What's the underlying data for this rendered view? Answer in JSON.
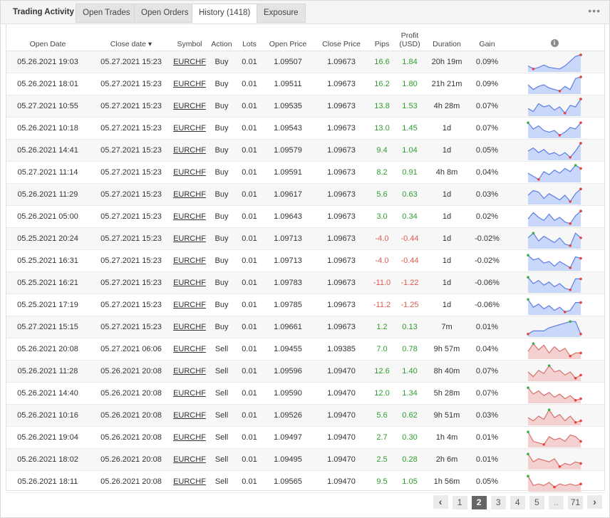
{
  "tabs": {
    "title": "Trading Activity",
    "items": [
      "Open Trades",
      "Open Orders",
      "History (1418)",
      "Exposure"
    ],
    "more_icon": "more-dots-icon"
  },
  "columns": {
    "open_date": "Open Date",
    "close_date": "Close date",
    "sort_indicator": "▾",
    "symbol": "Symbol",
    "action": "Action",
    "lots": "Lots",
    "open_price": "Open Price",
    "close_price": "Close Price",
    "pips": "Pips",
    "profit_line1": "Profit",
    "profit_line2": "(USD)",
    "duration": "Duration",
    "gain": "Gain",
    "info_icon": "i"
  },
  "colors": {
    "positive": "#2e9e2e",
    "negative": "#e05a4f",
    "buy_fill": "#c9d7fb",
    "buy_line": "#5d7de6",
    "sell_fill": "#f3d1d1",
    "sell_line": "#d9706c"
  },
  "rows": [
    {
      "open": "05.26.2021 19:03",
      "close": "05.27.2021 15:23",
      "symbol": "EURCHF",
      "action": "Buy",
      "lots": "0.01",
      "open_price": "1.09507",
      "close_price": "1.09673",
      "pips": "16.6",
      "profit": "1.84",
      "duration": "20h 19m",
      "gain": "0.09%",
      "sign": "pos",
      "spark": [
        0.3,
        0.1,
        0.2,
        0.35,
        0.2,
        0.15,
        0.1,
        0.3,
        0.6,
        0.9,
        1.0
      ]
    },
    {
      "open": "05.26.2021 18:01",
      "close": "05.27.2021 15:23",
      "symbol": "EURCHF",
      "action": "Buy",
      "lots": "0.01",
      "open_price": "1.09511",
      "close_price": "1.09673",
      "pips": "16.2",
      "profit": "1.80",
      "duration": "21h 21m",
      "gain": "0.09%",
      "sign": "pos",
      "spark": [
        0.5,
        0.2,
        0.4,
        0.5,
        0.3,
        0.2,
        0.1,
        0.4,
        0.2,
        0.9,
        1.0
      ]
    },
    {
      "open": "05.27.2021 10:55",
      "close": "05.27.2021 15:23",
      "symbol": "EURCHF",
      "action": "Buy",
      "lots": "0.01",
      "open_price": "1.09535",
      "close_price": "1.09673",
      "pips": "13.8",
      "profit": "1.53",
      "duration": "4h 28m",
      "gain": "0.07%",
      "sign": "pos",
      "spark": [
        0.4,
        0.2,
        0.7,
        0.5,
        0.6,
        0.3,
        0.5,
        0.1,
        0.6,
        0.5,
        1.0
      ]
    },
    {
      "open": "05.26.2021 10:18",
      "close": "05.27.2021 15:23",
      "symbol": "EURCHF",
      "action": "Buy",
      "lots": "0.01",
      "open_price": "1.09543",
      "close_price": "1.09673",
      "pips": "13.0",
      "profit": "1.45",
      "duration": "1d",
      "gain": "0.07%",
      "sign": "pos",
      "spark": [
        0.9,
        0.5,
        0.7,
        0.4,
        0.3,
        0.4,
        0.1,
        0.3,
        0.6,
        0.5,
        0.9
      ]
    },
    {
      "open": "05.26.2021 14:41",
      "close": "05.27.2021 15:23",
      "symbol": "EURCHF",
      "action": "Buy",
      "lots": "0.01",
      "open_price": "1.09579",
      "close_price": "1.09673",
      "pips": "9.4",
      "profit": "1.04",
      "duration": "1d",
      "gain": "0.05%",
      "sign": "pos",
      "spark": [
        0.5,
        0.7,
        0.4,
        0.6,
        0.3,
        0.4,
        0.2,
        0.4,
        0.1,
        0.5,
        1.0
      ]
    },
    {
      "open": "05.27.2021 11:14",
      "close": "05.27.2021 15:23",
      "symbol": "EURCHF",
      "action": "Buy",
      "lots": "0.01",
      "open_price": "1.09591",
      "close_price": "1.09673",
      "pips": "8.2",
      "profit": "0.91",
      "duration": "4h 8m",
      "gain": "0.04%",
      "sign": "pos",
      "spark": [
        0.5,
        0.3,
        0.1,
        0.6,
        0.4,
        0.7,
        0.5,
        0.8,
        0.6,
        1.0,
        0.8
      ]
    },
    {
      "open": "05.26.2021 11:29",
      "close": "05.27.2021 15:23",
      "symbol": "EURCHF",
      "action": "Buy",
      "lots": "0.01",
      "open_price": "1.09617",
      "close_price": "1.09673",
      "pips": "5.6",
      "profit": "0.63",
      "duration": "1d",
      "gain": "0.03%",
      "sign": "pos",
      "spark": [
        0.5,
        0.8,
        0.7,
        0.3,
        0.6,
        0.4,
        0.2,
        0.5,
        0.1,
        0.6,
        0.9
      ]
    },
    {
      "open": "05.26.2021 05:00",
      "close": "05.27.2021 15:23",
      "symbol": "EURCHF",
      "action": "Buy",
      "lots": "0.01",
      "open_price": "1.09643",
      "close_price": "1.09673",
      "pips": "3.0",
      "profit": "0.34",
      "duration": "1d",
      "gain": "0.02%",
      "sign": "pos",
      "spark": [
        0.4,
        0.8,
        0.5,
        0.3,
        0.7,
        0.3,
        0.5,
        0.2,
        0.1,
        0.6,
        0.9
      ]
    },
    {
      "open": "05.25.2021 20:24",
      "close": "05.27.2021 15:23",
      "symbol": "EURCHF",
      "action": "Buy",
      "lots": "0.01",
      "open_price": "1.09713",
      "close_price": "1.09673",
      "pips": "-4.0",
      "profit": "-0.44",
      "duration": "1d",
      "gain": "-0.02%",
      "sign": "neg",
      "spark": [
        0.6,
        0.9,
        0.4,
        0.7,
        0.5,
        0.3,
        0.6,
        0.2,
        0.1,
        0.9,
        0.6
      ]
    },
    {
      "open": "05.25.2021 16:31",
      "close": "05.27.2021 15:23",
      "symbol": "EURCHF",
      "action": "Buy",
      "lots": "0.01",
      "open_price": "1.09713",
      "close_price": "1.09673",
      "pips": "-4.0",
      "profit": "-0.44",
      "duration": "1d",
      "gain": "-0.02%",
      "sign": "neg",
      "spark": [
        0.9,
        0.6,
        0.7,
        0.4,
        0.5,
        0.2,
        0.5,
        0.3,
        0.1,
        0.8,
        0.7
      ]
    },
    {
      "open": "05.25.2021 16:21",
      "close": "05.27.2021 15:23",
      "symbol": "EURCHF",
      "action": "Buy",
      "lots": "0.01",
      "open_price": "1.09783",
      "close_price": "1.09673",
      "pips": "-11.0",
      "profit": "-1.22",
      "duration": "1d",
      "gain": "-0.06%",
      "sign": "neg",
      "spark": [
        0.9,
        0.5,
        0.7,
        0.4,
        0.6,
        0.3,
        0.5,
        0.2,
        0.1,
        0.8,
        0.8
      ]
    },
    {
      "open": "05.25.2021 17:19",
      "close": "05.27.2021 15:23",
      "symbol": "EURCHF",
      "action": "Buy",
      "lots": "0.01",
      "open_price": "1.09785",
      "close_price": "1.09673",
      "pips": "-11.2",
      "profit": "-1.25",
      "duration": "1d",
      "gain": "-0.06%",
      "sign": "neg",
      "spark": [
        0.9,
        0.4,
        0.6,
        0.3,
        0.5,
        0.2,
        0.4,
        0.1,
        0.2,
        0.7,
        0.7
      ]
    },
    {
      "open": "05.27.2021 15:15",
      "close": "05.27.2021 15:23",
      "symbol": "EURCHF",
      "action": "Buy",
      "lots": "0.01",
      "open_price": "1.09661",
      "close_price": "1.09673",
      "pips": "1.2",
      "profit": "0.13",
      "duration": "7m",
      "gain": "0.01%",
      "sign": "pos",
      "spark": [
        0.1,
        0.3,
        0.3,
        0.3,
        0.5,
        0.6,
        0.7,
        0.8,
        0.9,
        0.9,
        0.1
      ]
    },
    {
      "open": "05.26.2021 20:08",
      "close": "05.27.2021 06:06",
      "symbol": "EURCHF",
      "action": "Sell",
      "lots": "0.01",
      "open_price": "1.09455",
      "close_price": "1.09385",
      "pips": "7.0",
      "profit": "0.78",
      "duration": "9h 57m",
      "gain": "0.04%",
      "sign": "pos",
      "spark": [
        0.4,
        0.9,
        0.5,
        0.8,
        0.3,
        0.7,
        0.4,
        0.6,
        0.1,
        0.3,
        0.3
      ]
    },
    {
      "open": "05.26.2021 11:28",
      "close": "05.26.2021 20:08",
      "symbol": "EURCHF",
      "action": "Sell",
      "lots": "0.01",
      "open_price": "1.09596",
      "close_price": "1.09470",
      "pips": "12.6",
      "profit": "1.40",
      "duration": "8h 40m",
      "gain": "0.07%",
      "sign": "pos",
      "spark": [
        0.5,
        0.2,
        0.6,
        0.4,
        0.9,
        0.5,
        0.6,
        0.3,
        0.5,
        0.1,
        0.3
      ]
    },
    {
      "open": "05.26.2021 14:40",
      "close": "05.26.2021 20:08",
      "symbol": "EURCHF",
      "action": "Sell",
      "lots": "0.01",
      "open_price": "1.09590",
      "close_price": "1.09470",
      "pips": "12.0",
      "profit": "1.34",
      "duration": "5h 28m",
      "gain": "0.07%",
      "sign": "pos",
      "spark": [
        0.9,
        0.5,
        0.7,
        0.4,
        0.6,
        0.3,
        0.5,
        0.2,
        0.4,
        0.1,
        0.2
      ]
    },
    {
      "open": "05.26.2021 10:16",
      "close": "05.26.2021 20:08",
      "symbol": "EURCHF",
      "action": "Sell",
      "lots": "0.01",
      "open_price": "1.09526",
      "close_price": "1.09470",
      "pips": "5.6",
      "profit": "0.62",
      "duration": "9h 51m",
      "gain": "0.03%",
      "sign": "pos",
      "spark": [
        0.4,
        0.2,
        0.5,
        0.3,
        0.9,
        0.4,
        0.6,
        0.2,
        0.5,
        0.1,
        0.2
      ]
    },
    {
      "open": "05.26.2021 19:04",
      "close": "05.26.2021 20:08",
      "symbol": "EURCHF",
      "action": "Sell",
      "lots": "0.01",
      "open_price": "1.09497",
      "close_price": "1.09470",
      "pips": "2.7",
      "profit": "0.30",
      "duration": "1h 4m",
      "gain": "0.01%",
      "sign": "pos",
      "spark": [
        0.9,
        0.3,
        0.2,
        0.1,
        0.6,
        0.4,
        0.5,
        0.3,
        0.7,
        0.6,
        0.3
      ]
    },
    {
      "open": "05.26.2021 18:02",
      "close": "05.26.2021 20:08",
      "symbol": "EURCHF",
      "action": "Sell",
      "lots": "0.01",
      "open_price": "1.09495",
      "close_price": "1.09470",
      "pips": "2.5",
      "profit": "0.28",
      "duration": "2h 6m",
      "gain": "0.01%",
      "sign": "pos",
      "spark": [
        0.9,
        0.4,
        0.6,
        0.5,
        0.4,
        0.6,
        0.1,
        0.3,
        0.2,
        0.4,
        0.3
      ]
    },
    {
      "open": "05.26.2021 18:11",
      "close": "05.26.2021 20:08",
      "symbol": "EURCHF",
      "action": "Sell",
      "lots": "0.01",
      "open_price": "1.09565",
      "close_price": "1.09470",
      "pips": "9.5",
      "profit": "1.05",
      "duration": "1h 56m",
      "gain": "0.05%",
      "sign": "pos",
      "spark": [
        0.9,
        0.3,
        0.4,
        0.3,
        0.5,
        0.2,
        0.4,
        0.3,
        0.4,
        0.3,
        0.4
      ]
    }
  ],
  "pager": {
    "prev": "‹",
    "pages": [
      "1",
      "2",
      "3",
      "4",
      "5"
    ],
    "active": "2",
    "ellipsis": "..",
    "last": "71",
    "next": "›"
  }
}
